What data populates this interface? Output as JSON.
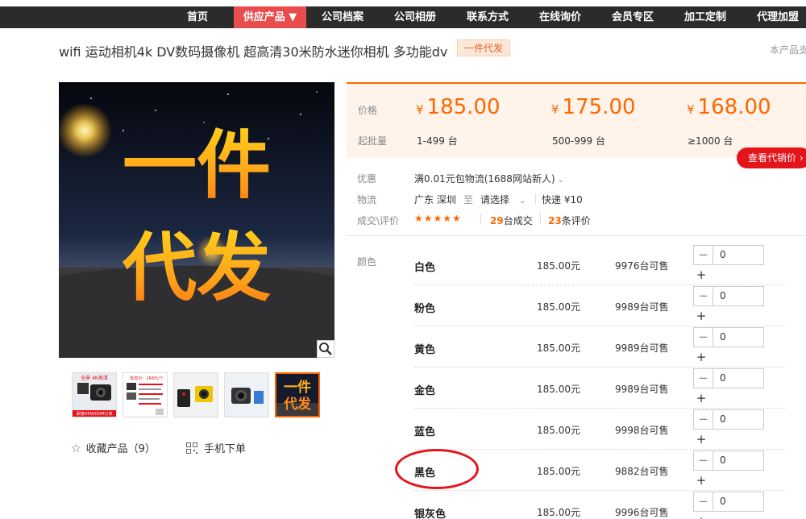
{
  "nav": {
    "items": [
      "首页",
      "供应产品 ▼",
      "公司档案",
      "公司相册",
      "联系方式",
      "在线询价",
      "会员专区",
      "加工定制",
      "代理加盟"
    ]
  },
  "product": {
    "title": "wifi 运动相机4k DV数码摄像机 超高清30米防水迷你相机 多功能dv",
    "badge": "一件代发",
    "support_note": "本产品支"
  },
  "main_image": {
    "overlay_line1": "一件",
    "overlay_line2": "代发"
  },
  "thumbnails": {
    "t1_top": "全景 4K高清",
    "t1_bottom": "承接OEM/ODM订单",
    "t2_top": "批发价：168元/个",
    "t5_line1": "一件",
    "t5_line2": "代发"
  },
  "actions": {
    "favorite": "收藏产品（9）",
    "mobile_order": "手机下单"
  },
  "pricing": {
    "price_label": "价格",
    "qty_label": "起批量",
    "currency": "¥",
    "tiers": [
      {
        "price": "185.00",
        "qty": "1-499 台"
      },
      {
        "price": "175.00",
        "qty": "500-999 台"
      },
      {
        "price": "168.00",
        "qty": "≥1000 台"
      }
    ],
    "agent_button": "查看代销价 ›"
  },
  "info": {
    "promo_label": "优惠",
    "promo_value": "满0.01元包物流(1688网站新人)",
    "logistics_label": "物流",
    "logistics_from": "广东 深圳",
    "logistics_to_word": "至",
    "logistics_select": "请选择",
    "logistics_express": "快递 ¥10",
    "deals_label": "成交\\评价",
    "stars": "★★★★★",
    "deals_count": "29",
    "deals_suffix": "台成交",
    "review_count": "23",
    "review_suffix": "条评价"
  },
  "variants": {
    "label": "颜色",
    "rows": [
      {
        "name": "白色",
        "price": "185.00元",
        "stock": "9976台可售",
        "qty": "0"
      },
      {
        "name": "粉色",
        "price": "185.00元",
        "stock": "9989台可售",
        "qty": "0"
      },
      {
        "name": "黄色",
        "price": "185.00元",
        "stock": "9989台可售",
        "qty": "0"
      },
      {
        "name": "金色",
        "price": "185.00元",
        "stock": "9989台可售",
        "qty": "0"
      },
      {
        "name": "蓝色",
        "price": "185.00元",
        "stock": "9998台可售",
        "qty": "0"
      },
      {
        "name": "黑色",
        "price": "185.00元",
        "stock": "9882台可售",
        "qty": "0"
      },
      {
        "name": "银灰色",
        "price": "185.00元",
        "stock": "9996台可售",
        "qty": "0"
      }
    ]
  },
  "colors": {
    "accent": "#ff6600",
    "nav_bg": "#2b2b2b",
    "nav_active": "#e84c4c",
    "agent_button": "#e4141b",
    "annotation": "#e8121c"
  },
  "icons": {
    "zoom": "magnifier-icon",
    "favorite": "star-outline-icon",
    "mobile": "qr-code-icon",
    "dropdown": "chevron-down-icon"
  }
}
